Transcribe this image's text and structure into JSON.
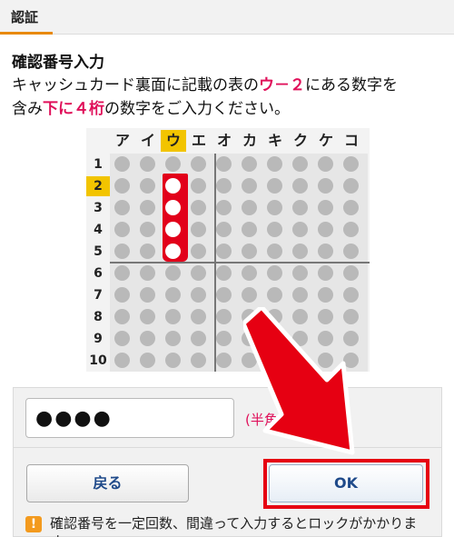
{
  "header": {
    "tab_label": "認証"
  },
  "prompt": {
    "title": "確認番号入力",
    "line1_before": "キャッシュカード裏面に記載の表の",
    "line1_highlight": "ウ－２",
    "line1_after": "にある数字を",
    "line2_before": "含み",
    "line2_highlight": "下に４桁",
    "line2_after": "の数字をご入力ください。"
  },
  "grid": {
    "columns": [
      "ア",
      "イ",
      "ウ",
      "エ",
      "オ",
      "カ",
      "キ",
      "ク",
      "ケ",
      "コ"
    ],
    "rows": [
      "1",
      "2",
      "3",
      "4",
      "5",
      "6",
      "7",
      "8",
      "9",
      "10"
    ],
    "selected_column": "ウ",
    "selected_row": "2",
    "highlighted_rows": [
      "2",
      "3",
      "4",
      "5"
    ]
  },
  "form": {
    "pin_value": "●●●●",
    "half_width_note": "(半角"
  },
  "buttons": {
    "back_label": "戻る",
    "ok_label": "OK"
  },
  "notice": {
    "icon": "!",
    "text": "確認番号を一定回数、間違って入力するとロックがかかります。"
  },
  "colors": {
    "accent_pink": "#e0105a",
    "highlight_yellow": "#f2c400",
    "selection_red": "#e2001a",
    "arrow_red": "#e60012"
  }
}
